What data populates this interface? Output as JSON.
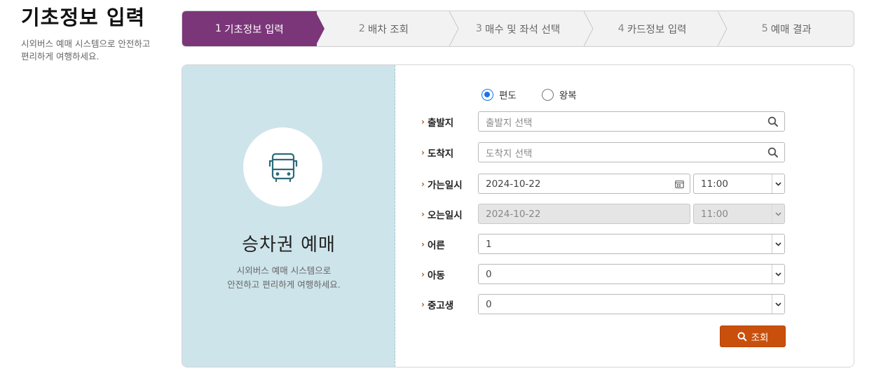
{
  "side": {
    "title": "기초정보 입력",
    "desc": "시외버스 예매 시스템으로 안전하고 편리하게 여행하세요."
  },
  "steps": [
    {
      "num": "1",
      "label": "기초정보 입력",
      "active": true
    },
    {
      "num": "2",
      "label": "배차 조회",
      "active": false
    },
    {
      "num": "3",
      "label": "매수 및 좌석 선택",
      "active": false
    },
    {
      "num": "4",
      "label": "카드정보 입력",
      "active": false
    },
    {
      "num": "5",
      "label": "예매 결과",
      "active": false
    }
  ],
  "panel": {
    "title": "승차권 예매",
    "desc_line1": "시외버스 예매 시스템으로",
    "desc_line2": "안전하고 편리하게 여행하세요."
  },
  "trip_type": {
    "one_way": "편도",
    "round_trip": "왕복",
    "selected": "one_way"
  },
  "form": {
    "departure_label": "출발지",
    "departure_placeholder": "출발지 선택",
    "arrival_label": "도착지",
    "arrival_placeholder": "도착지 선택",
    "go_label": "가는일시",
    "go_date": "2024-10-22",
    "go_time": "11:00",
    "return_label": "오는일시",
    "return_date": "2024-10-22",
    "return_time": "11:00",
    "adult_label": "어른",
    "adult_value": "1",
    "child_label": "아동",
    "child_value": "0",
    "teen_label": "중고생",
    "teen_value": "0",
    "search_label": "조회"
  },
  "colors": {
    "accent_purple": "#7b3679",
    "search_orange": "#c9500c",
    "panel_blue": "#cde4ea",
    "radio_blue": "#1a73e8",
    "icon_teal": "#2d6b78"
  }
}
